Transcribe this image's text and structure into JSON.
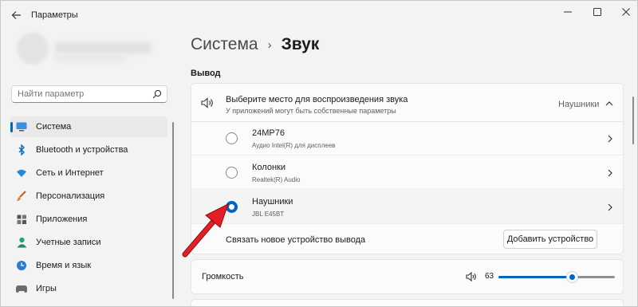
{
  "window": {
    "title": "Параметры",
    "controls": [
      "minimize-icon",
      "maximize-icon",
      "close-icon"
    ]
  },
  "sidebar": {
    "search": {
      "placeholder": "Найти параметр",
      "value": ""
    },
    "items": [
      {
        "label": "Система",
        "icon": "monitor-icon",
        "active": true
      },
      {
        "label": "Bluetooth и устройства",
        "icon": "bluetooth-icon",
        "active": false
      },
      {
        "label": "Сеть и Интернет",
        "icon": "wifi-icon",
        "active": false
      },
      {
        "label": "Персонализация",
        "icon": "brush-icon",
        "active": false
      },
      {
        "label": "Приложения",
        "icon": "apps-icon",
        "active": false
      },
      {
        "label": "Учетные записи",
        "icon": "person-icon",
        "active": false
      },
      {
        "label": "Время и язык",
        "icon": "globe-clock-icon",
        "active": false
      },
      {
        "label": "Игры",
        "icon": "gamepad-icon",
        "active": false
      }
    ]
  },
  "breadcrumb": {
    "parent": "Система",
    "separator": "›",
    "current": "Звук"
  },
  "output": {
    "section_title": "Вывод",
    "header": {
      "title": "Выберите место для воспроизведения звука",
      "subtitle": "У приложений могут быть собственные параметры",
      "selected_value": "Наушники"
    },
    "devices": [
      {
        "name": "24MP76",
        "description": "Аудио Intel(R) для дисплеев",
        "selected": false
      },
      {
        "name": "Колонки",
        "description": "Realtek(R) Audio",
        "selected": false
      },
      {
        "name": "Наушники",
        "description": "JBL E45BT",
        "selected": true
      }
    ],
    "pair": {
      "label": "Связать новое устройство вывода",
      "button": "Добавить устройство"
    }
  },
  "volume": {
    "label": "Громкость",
    "value": "63",
    "level": 0.63
  },
  "colors": {
    "accent": "#0067c0",
    "annotation_arrow": "#e31e24"
  }
}
